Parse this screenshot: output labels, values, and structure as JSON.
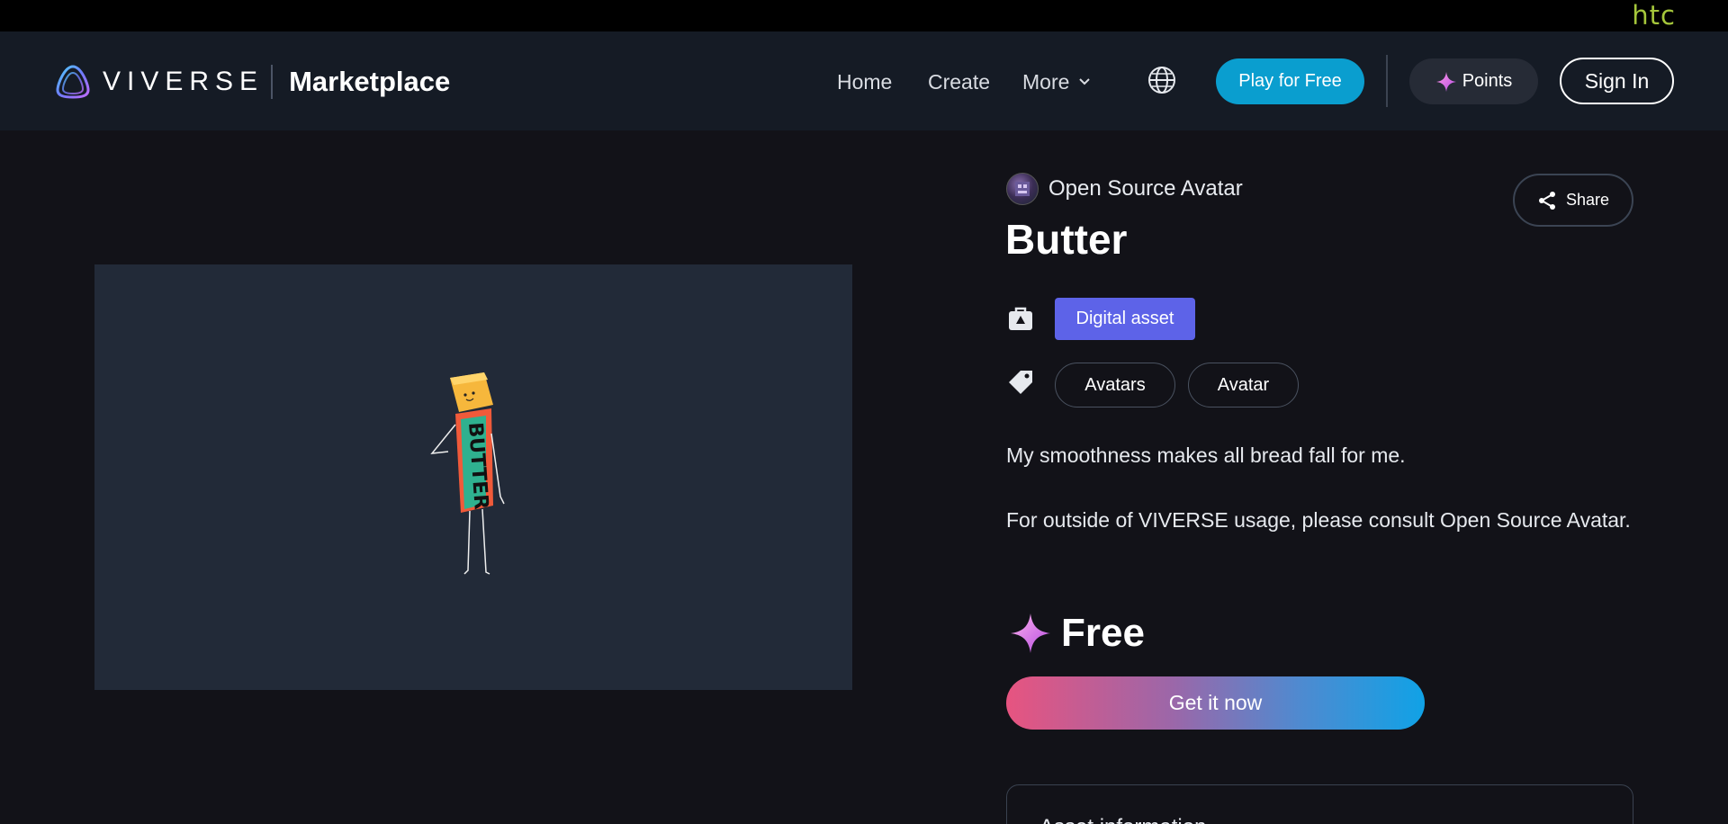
{
  "htc": {
    "logo_text": "htc"
  },
  "header": {
    "brand_word": "VIVERSE",
    "brand_section": "Marketplace",
    "nav": {
      "home": "Home",
      "create": "Create",
      "more": "More"
    },
    "play_label": "Play for Free",
    "points_label": "Points",
    "signin_label": "Sign In"
  },
  "asset": {
    "creator": "Open Source Avatar",
    "title": "Butter",
    "share_label": "Share",
    "type_badge": "Digital asset",
    "tags": [
      "Avatars",
      "Avatar"
    ],
    "description_1": "My smoothness makes all bread fall for me.",
    "description_2": "For outside of VIVERSE usage, please consult Open Source Avatar.",
    "price_label": "Free",
    "cta_label": "Get it now",
    "info_title": "Asset information",
    "preview_character_text": "BUTTER"
  },
  "colors": {
    "accent_play": "#0a9ecf",
    "badge_asset": "#5d63e8",
    "htc_green": "#a5c63b",
    "cta_gradient_start": "#e75480",
    "cta_gradient_end": "#10a2e6"
  },
  "icons": [
    "viverse-logo-icon",
    "chevron-down-icon",
    "globe-icon",
    "sparkle-icon",
    "share-icon",
    "bag-icon",
    "tag-icon"
  ]
}
